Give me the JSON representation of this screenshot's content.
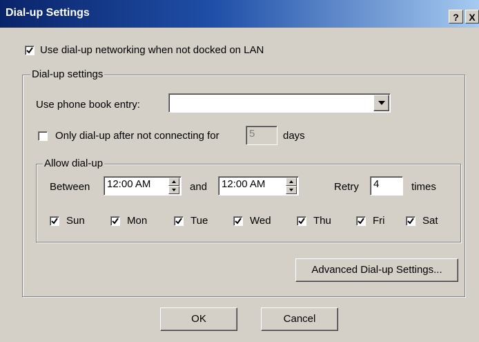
{
  "window": {
    "title": "Dial-up Settings",
    "help_label": "?",
    "close_label": "X"
  },
  "use_dialup": {
    "label": "Use dial-up networking when not docked on LAN",
    "checked": true
  },
  "dialup_group": {
    "legend": "Dial-up settings",
    "phonebook_label": "Use phone book entry:",
    "phonebook_value": "",
    "only_after_label": "Only dial-up after not connecting for",
    "only_after_checked": false,
    "days_value": "5",
    "days_label": "days"
  },
  "allow_group": {
    "legend": "Allow dial-up",
    "between_label": "Between",
    "start_time": "12:00 AM",
    "and_label": "and",
    "end_time": "12:00 AM",
    "retry_label": "Retry",
    "retry_value": "4",
    "times_label": "times",
    "days": [
      {
        "label": "Sun",
        "checked": true
      },
      {
        "label": "Mon",
        "checked": true
      },
      {
        "label": "Tue",
        "checked": true
      },
      {
        "label": "Wed",
        "checked": true
      },
      {
        "label": "Thu",
        "checked": true
      },
      {
        "label": "Fri",
        "checked": true
      },
      {
        "label": "Sat",
        "checked": true
      }
    ]
  },
  "buttons": {
    "advanced": "Advanced Dial-up Settings...",
    "ok": "OK",
    "cancel": "Cancel"
  }
}
